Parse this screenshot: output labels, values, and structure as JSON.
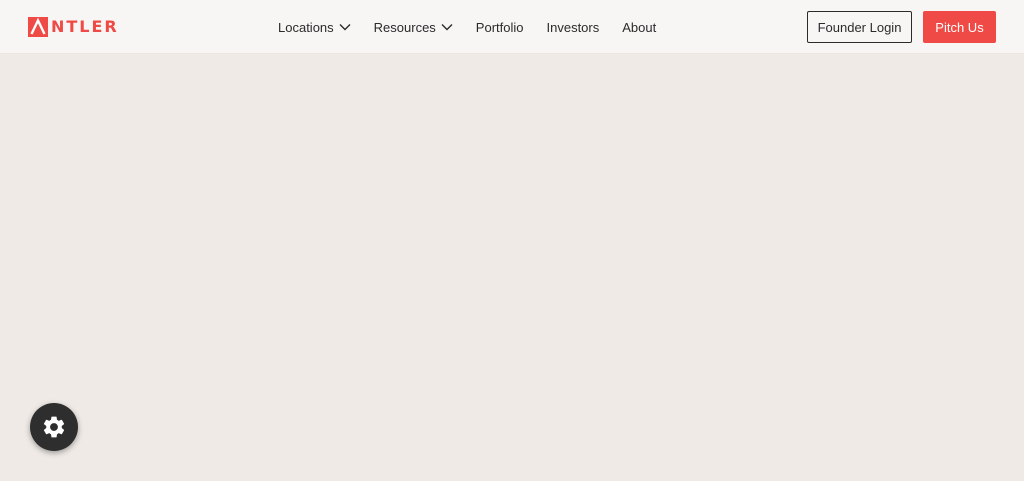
{
  "header": {
    "logo": {
      "text": "NTLER",
      "brand_color": "#ef4a45",
      "icon": "antler-logo-icon"
    },
    "nav": [
      {
        "label": "Locations",
        "has_dropdown": true,
        "icon": "chevron-down-icon"
      },
      {
        "label": "Resources",
        "has_dropdown": true,
        "icon": "chevron-down-icon"
      },
      {
        "label": "Portfolio",
        "has_dropdown": false
      },
      {
        "label": "Investors",
        "has_dropdown": false
      },
      {
        "label": "About",
        "has_dropdown": false
      }
    ],
    "founder_login_label": "Founder Login",
    "pitch_us_label": "Pitch Us"
  },
  "colors": {
    "accent": "#ef4a45",
    "header_bg": "#f8f6f4",
    "page_bg": "#efeae6",
    "text": "#2b2b2b",
    "fab_bg": "#2e2e2e"
  },
  "settings_fab": {
    "icon": "gear-icon"
  }
}
